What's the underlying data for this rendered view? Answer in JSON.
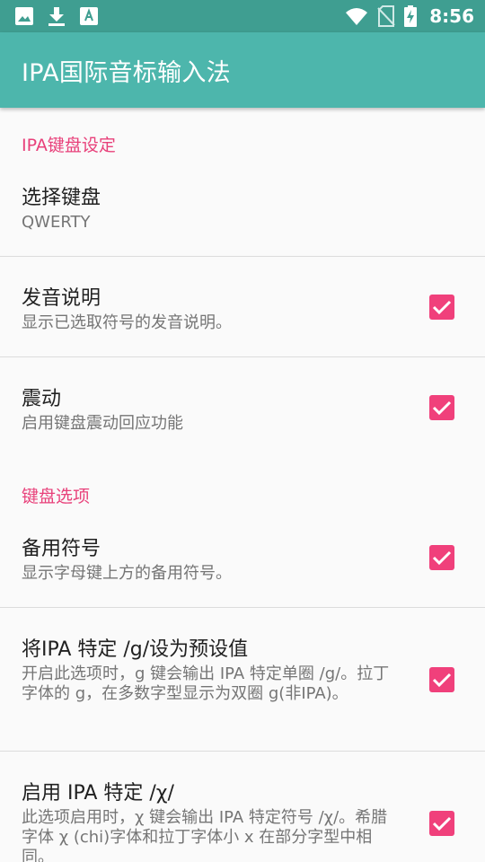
{
  "status_bar": {
    "time": "8:56",
    "left_icons": [
      "image-icon",
      "download-icon",
      "font-a-icon"
    ],
    "right_icons": [
      "wifi-icon",
      "no-sim-icon",
      "battery-charging-icon"
    ],
    "background": "#3f9e91"
  },
  "app_bar": {
    "title": "IPA国际音标输入法",
    "background": "#4db6ac"
  },
  "accent_color": "#f0407b",
  "sections": [
    {
      "header": "IPA键盘设定",
      "items": [
        {
          "title": "选择键盘",
          "summary": "QWERTY"
        },
        {
          "title": "发音说明",
          "summary": "显示已选取符号的发音说明。",
          "checked": true
        },
        {
          "title": "震动",
          "summary": "启用键盘震动回应功能",
          "checked": true
        }
      ]
    },
    {
      "header": "键盘选项",
      "items": [
        {
          "title": "备用符号",
          "summary": "显示字母键上方的备用符号。",
          "checked": true
        },
        {
          "title": "将IPA 特定 /g/设为预设值",
          "summary": "开启此选项时，g 键会输出 IPA 特定单圈 /g/。拉丁字体的 g，在多数字型显示为双圈 g(非IPA)。",
          "checked": true
        },
        {
          "title": "启用 IPA 特定 /χ/",
          "summary": "此选项启用时，χ 键会输出 IPA 特定符号 /χ/。希腊字体 χ (chi)字体和拉丁字体小 x 在部分字型中相同。",
          "checked": true
        }
      ]
    }
  ]
}
